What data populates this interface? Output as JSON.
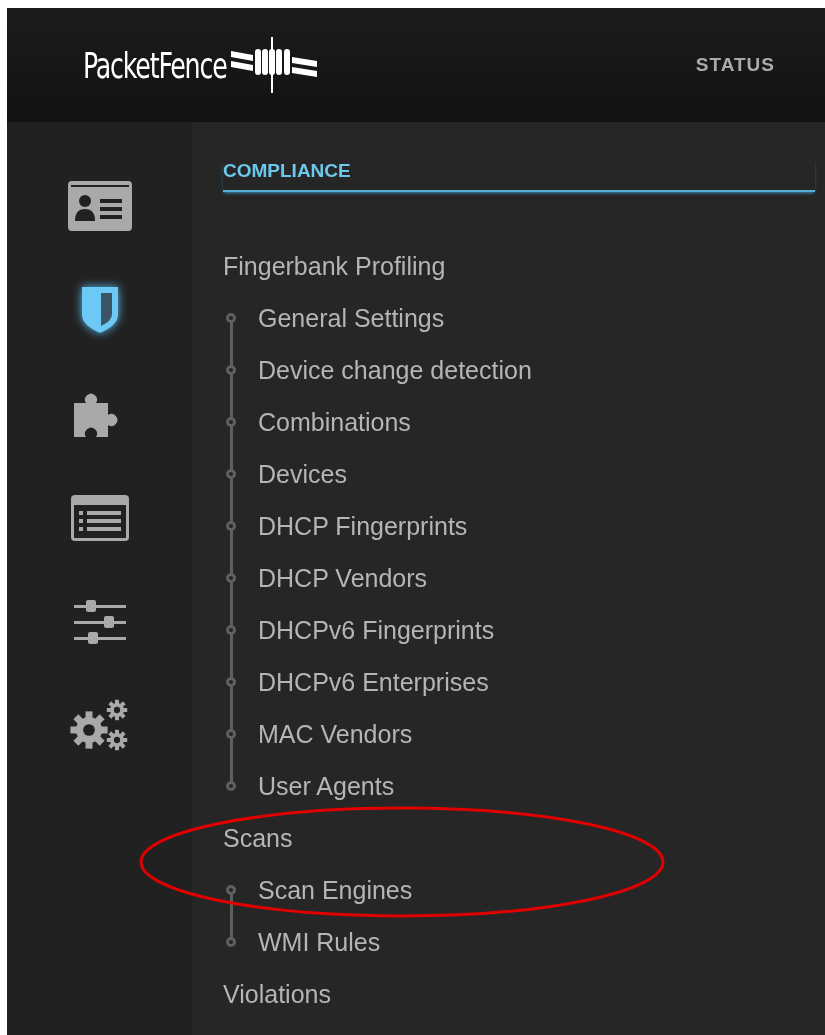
{
  "header": {
    "brand": "PacketFence",
    "nav": [
      "STATUS"
    ]
  },
  "sidebar": {
    "icons": [
      {
        "kind": "contact-card",
        "selected": false
      },
      {
        "kind": "shield",
        "selected": true
      },
      {
        "kind": "puzzle",
        "selected": false
      },
      {
        "kind": "list",
        "selected": false
      },
      {
        "kind": "sliders",
        "selected": false
      },
      {
        "kind": "gears",
        "selected": false
      }
    ]
  },
  "section_title": "COMPLIANCE",
  "menu": [
    {
      "label": "Fingerbank Profiling",
      "children": [
        {
          "label": "General Settings"
        },
        {
          "label": "Device change detection"
        },
        {
          "label": "Combinations"
        },
        {
          "label": "Devices"
        },
        {
          "label": "DHCP Fingerprints"
        },
        {
          "label": "DHCP Vendors"
        },
        {
          "label": "DHCPv6 Fingerprints"
        },
        {
          "label": "DHCPv6 Enterprises"
        },
        {
          "label": "MAC Vendors"
        },
        {
          "label": "User Agents"
        }
      ]
    },
    {
      "label": "Scans",
      "children": [
        {
          "label": "Scan Engines"
        },
        {
          "label": "WMI Rules"
        }
      ]
    },
    {
      "label": "Violations"
    }
  ],
  "annotation": {
    "kind": "ellipse",
    "color": "#e00000"
  }
}
